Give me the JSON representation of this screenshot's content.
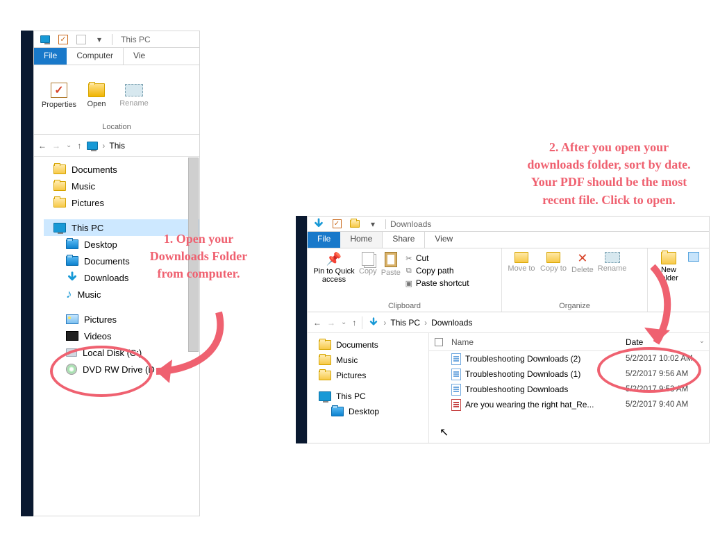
{
  "colors": {
    "accent": "#ef6170",
    "file_tab": "#1979ca"
  },
  "callouts": {
    "c1": "1. Open your Downloads Folder from computer.",
    "c2": "2. After you open your downloads folder, sort by date. Your PDF should be the most recent file.  Click to open."
  },
  "win1": {
    "title": "This PC",
    "tabs": {
      "file": "File",
      "computer": "Computer",
      "view": "Vie"
    },
    "ribbon": {
      "properties": "Properties",
      "open": "Open",
      "rename": "Rename",
      "group": "Location"
    },
    "breadcrumb": {
      "this": "This"
    },
    "tree": [
      {
        "label": "Documents",
        "icon": "folder"
      },
      {
        "label": "Music",
        "icon": "folder"
      },
      {
        "label": "Pictures",
        "icon": "folder"
      },
      {
        "label": "This PC",
        "icon": "monitor",
        "selected": true
      },
      {
        "label": "Desktop",
        "icon": "bluefold",
        "indent": true
      },
      {
        "label": "Documents",
        "icon": "bluefold",
        "indent": true
      },
      {
        "label": "Downloads",
        "icon": "download",
        "indent": true
      },
      {
        "label": "Music",
        "icon": "music",
        "indent": true
      },
      {
        "label": "Pictures",
        "icon": "pics",
        "indent": true
      },
      {
        "label": "Videos",
        "icon": "video",
        "indent": true
      },
      {
        "label": "Local Disk (C:)",
        "icon": "disk",
        "indent": true
      },
      {
        "label": "DVD RW Drive (D",
        "icon": "dvd",
        "indent": true
      }
    ]
  },
  "win2": {
    "title": "Downloads",
    "tabs": {
      "file": "File",
      "home": "Home",
      "share": "Share",
      "view": "View"
    },
    "ribbon": {
      "pin": "Pin to Quick access",
      "copy": "Copy",
      "paste": "Paste",
      "cut": "Cut",
      "copypath": "Copy path",
      "pasteshort": "Paste shortcut",
      "clipboard": "Clipboard",
      "moveto": "Move to",
      "copyto": "Copy to",
      "delete": "Delete",
      "rename": "Rename",
      "organize": "Organize",
      "newfolder": "New folder"
    },
    "breadcrumb": {
      "thispc": "This PC",
      "downloads": "Downloads"
    },
    "tree": [
      "Documents",
      "Music",
      "Pictures",
      "This PC",
      "Desktop"
    ],
    "columns": {
      "name": "Name",
      "date": "Date"
    },
    "rows": [
      {
        "name": "Troubleshooting Downloads (2)",
        "date": "5/2/2017 10:02 AM",
        "icon": "doc"
      },
      {
        "name": "Troubleshooting Downloads (1)",
        "date": "5/2/2017 9:56 AM",
        "icon": "doc"
      },
      {
        "name": "Troubleshooting Downloads",
        "date": "5/2/2017 9:53 AM",
        "icon": "doc"
      },
      {
        "name": "Are you wearing the right hat_Re...",
        "date": "5/2/2017 9:40 AM",
        "icon": "pdf"
      }
    ]
  }
}
